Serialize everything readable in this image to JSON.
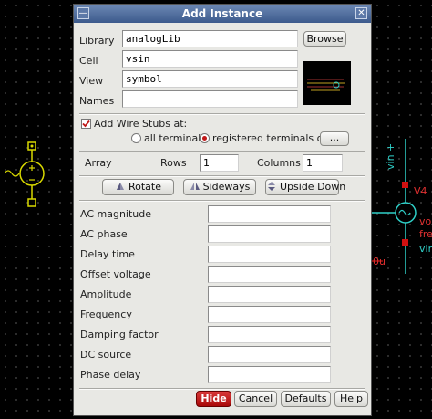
{
  "background": {
    "labels": {
      "vin_plus": "vin +",
      "v4": "V4",
      "vo": "vo",
      "fre": "fre",
      "vin": "vin",
      "u_value": "0u"
    },
    "colors": {
      "wire": "#2fd0c8",
      "pin": "#d8d800",
      "marker": "#d01010",
      "text_red": "#e03030"
    }
  },
  "dialog": {
    "title": "Add Instance",
    "title_buttons": [
      "—",
      "✕"
    ],
    "fields": {
      "library": {
        "label": "Library",
        "value": "analogLib",
        "browse_label": "Browse"
      },
      "cell": {
        "label": "Cell",
        "value": "vsin"
      },
      "view": {
        "label": "View",
        "value": "symbol"
      },
      "names": {
        "label": "Names",
        "value": ""
      }
    },
    "wire_stubs": {
      "label": "Add Wire Stubs at:",
      "checked": true,
      "option_all": "all terminals",
      "option_registered": "registered terminals only",
      "selected": "registered",
      "more_label": "..."
    },
    "array": {
      "label": "Array",
      "rows_label": "Rows",
      "rows_value": "1",
      "columns_label": "Columns",
      "columns_value": "1"
    },
    "transform_buttons": {
      "rotate": "Rotate",
      "sideways": "Sideways",
      "upside_down": "Upside Down"
    },
    "parameters": [
      {
        "label": "AC magnitude",
        "value": ""
      },
      {
        "label": "AC phase",
        "value": ""
      },
      {
        "label": "Delay time",
        "value": ""
      },
      {
        "label": "Offset voltage",
        "value": ""
      },
      {
        "label": "Amplitude",
        "value": ""
      },
      {
        "label": "Frequency",
        "value": ""
      },
      {
        "label": "Damping factor",
        "value": ""
      },
      {
        "label": "DC source",
        "value": ""
      },
      {
        "label": "Phase delay",
        "value": ""
      }
    ],
    "footer_buttons": {
      "hide": "Hide",
      "cancel": "Cancel",
      "defaults": "Defaults",
      "help": "Help"
    }
  }
}
